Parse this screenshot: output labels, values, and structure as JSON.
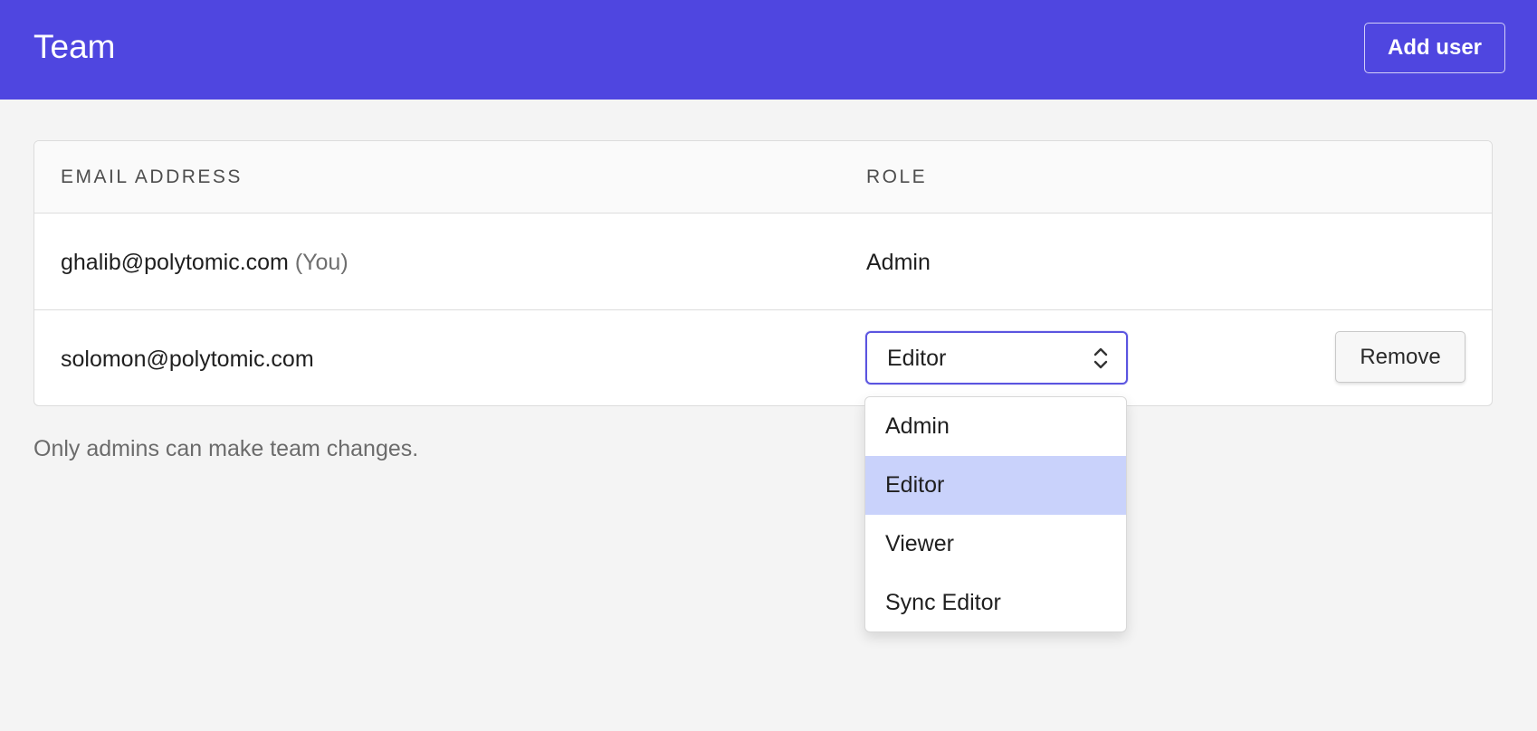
{
  "header": {
    "title": "Team",
    "add_user_label": "Add user"
  },
  "table": {
    "columns": {
      "email": "EMAIL ADDRESS",
      "role": "ROLE"
    },
    "rows": [
      {
        "email": "ghalib@polytomic.com",
        "tag": "(You)",
        "role": "Admin"
      },
      {
        "email": "solomon@polytomic.com",
        "role": "Editor",
        "remove_label": "Remove"
      }
    ]
  },
  "footnote": "Only admins can make team changes.",
  "role_dropdown": {
    "selected": "Editor",
    "options": [
      "Admin",
      "Editor",
      "Viewer",
      "Sync Editor"
    ],
    "highlighted_index": 1
  },
  "icons": {
    "select_arrow": "chevron-up-down-icon"
  },
  "colors": {
    "header_bg": "#4f46e0",
    "focus_border": "#5b55e0",
    "highlight_option": "#c9d2fb",
    "page_bg": "#f4f4f4"
  }
}
